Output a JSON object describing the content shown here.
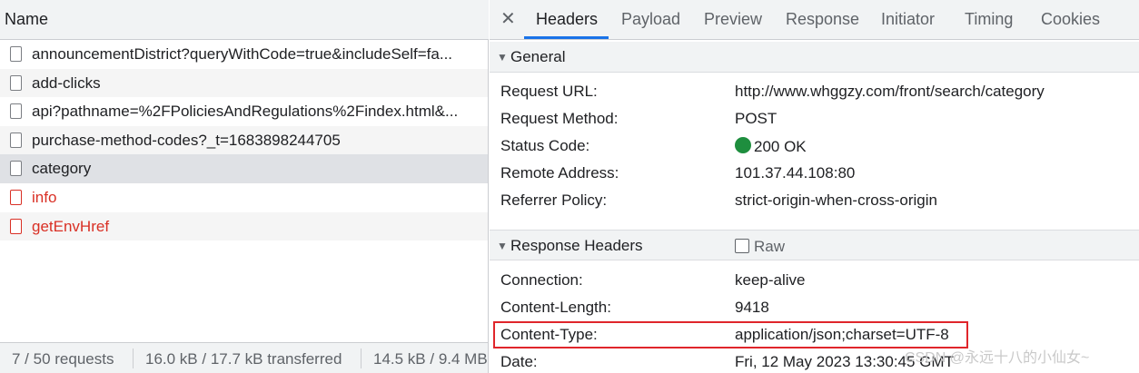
{
  "left": {
    "header": "Name",
    "requests": [
      {
        "name": "announcementDistrict?queryWithCode=true&includeSelf=fa...",
        "error": false
      },
      {
        "name": "add-clicks",
        "error": false
      },
      {
        "name": "api?pathname=%2FPoliciesAndRegulations%2Findex.html&...",
        "error": false
      },
      {
        "name": "purchase-method-codes?_t=1683898244705",
        "error": false
      },
      {
        "name": "category",
        "error": false,
        "selected": true
      },
      {
        "name": "info",
        "error": true
      },
      {
        "name": "getEnvHref",
        "error": true
      }
    ],
    "status": {
      "requests": "7 / 50 requests",
      "transferred": "16.0 kB / 17.7 kB transferred",
      "resources": "14.5 kB / 9.4 MB"
    }
  },
  "right": {
    "close": "✕",
    "tabs": [
      "Headers",
      "Payload",
      "Preview",
      "Response",
      "Initiator",
      "Timing",
      "Cookies"
    ],
    "general": {
      "title": "General",
      "rows": [
        {
          "key": "Request URL:",
          "value": "http://www.whggzy.com/front/search/category"
        },
        {
          "key": "Request Method:",
          "value": "POST"
        },
        {
          "key": "Status Code:",
          "value": "200 OK"
        },
        {
          "key": "Remote Address:",
          "value": "101.37.44.108:80"
        },
        {
          "key": "Referrer Policy:",
          "value": "strict-origin-when-cross-origin"
        }
      ]
    },
    "response_headers": {
      "title": "Response Headers",
      "raw_label": "Raw",
      "rows": [
        {
          "key": "Connection:",
          "value": "keep-alive"
        },
        {
          "key": "Content-Length:",
          "value": "9418"
        },
        {
          "key": "Content-Type:",
          "value": "application/json;charset=UTF-8"
        },
        {
          "key": "Date:",
          "value": "Fri, 12 May 2023 13:30:45 GMT"
        }
      ]
    }
  },
  "watermark": "CSDN @永远十八的小仙女~",
  "colors": {
    "accent": "#1a73e8",
    "error_text": "#d93025",
    "status_ok": "#1e8e3e",
    "highlight_border": "#e0262b"
  }
}
